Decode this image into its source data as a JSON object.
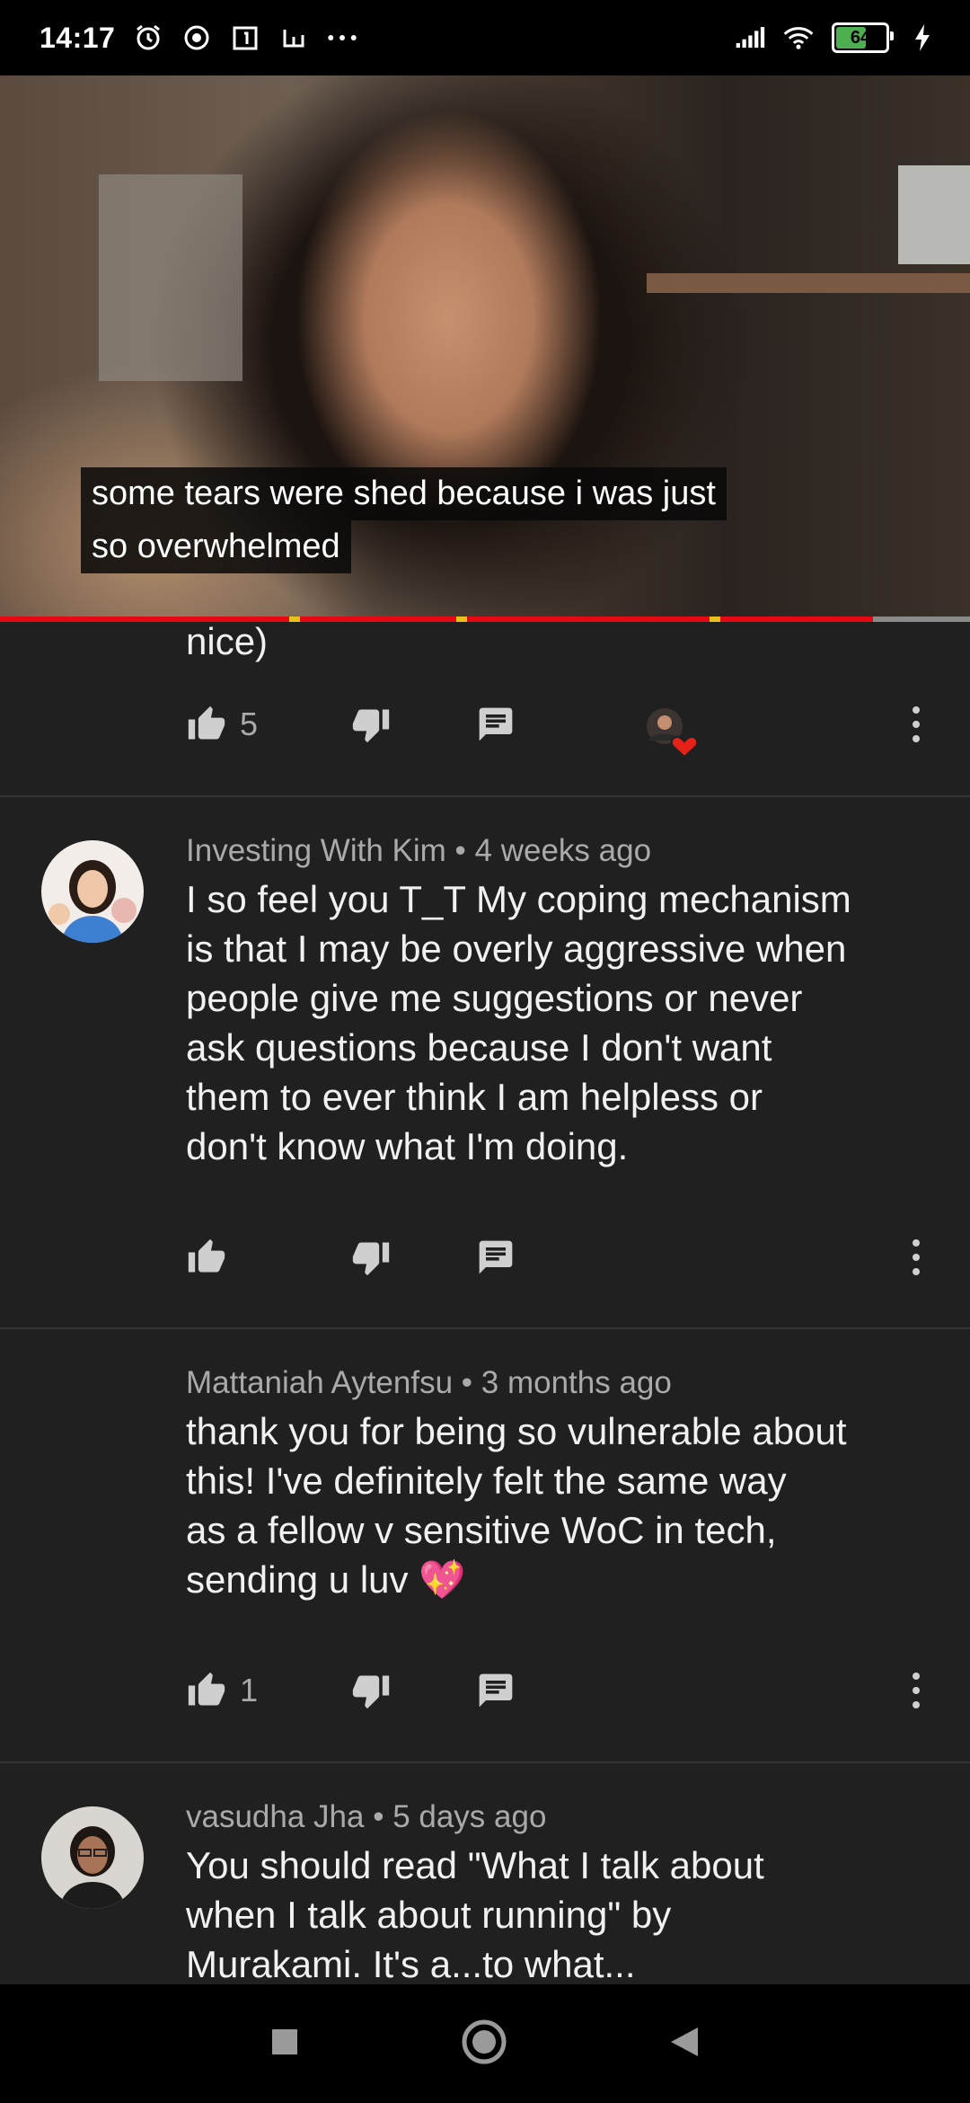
{
  "status_bar": {
    "time": "14:17",
    "battery_level": "64",
    "icons": [
      "alarm-icon",
      "messenger-icon",
      "calendar-icon",
      "app-icon",
      "more-icon",
      "signal-icon",
      "wifi-icon",
      "battery-icon",
      "charging-icon"
    ]
  },
  "video": {
    "subtitle_line1": "some tears were shed because i was just",
    "subtitle_line2": "so overwhelmed",
    "progress_fraction": 0.9
  },
  "comments": [
    {
      "text_tail": "nice)",
      "likes": "5",
      "creator_heart": true
    },
    {
      "author": "Investing With Kim",
      "time": "4 weeks ago",
      "lines": [
        "I so feel you T_T My coping mechanism",
        "is that I may be overly aggressive when",
        "people give me suggestions or never",
        "ask questions because I don't want",
        "them to ever think I am helpless or",
        "don't know what I'm doing."
      ],
      "likes": ""
    },
    {
      "author": "Mattaniah Aytenfsu",
      "time": "3 months ago",
      "lines": [
        "thank you for being so vulnerable about",
        "this! I've definitely felt the same way",
        "as a fellow v sensitive WoC in tech,",
        "sending u luv 💖"
      ],
      "likes": "1"
    },
    {
      "author": "vasudha Jha",
      "time": "5 days ago",
      "lines": [
        "You should read \"What I talk about",
        "when I talk about running\" by",
        "Murakami. It's a...to what..."
      ],
      "likes": ""
    }
  ],
  "separator": " • ",
  "colors": {
    "background": "#202020",
    "progress_played": "#e50914",
    "heart": "#e62117"
  }
}
